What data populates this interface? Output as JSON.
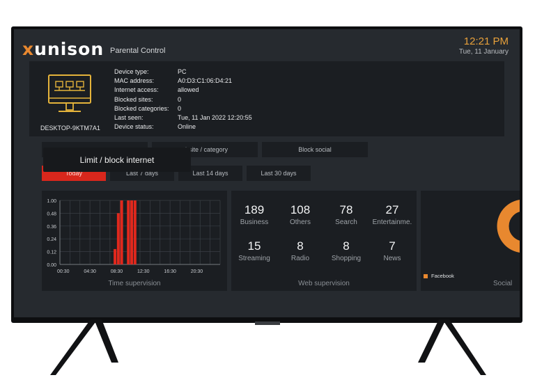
{
  "header": {
    "logo_x": "x",
    "logo_rest": "unison",
    "app_title": "Parental Control",
    "time": "12:21 PM",
    "date": "Tue, 11 January"
  },
  "device": {
    "name": "DESKTOP-9KTM7A1",
    "fields": [
      {
        "label": "Device type:",
        "value": "PC"
      },
      {
        "label": "MAC address:",
        "value": "A0:D3:C1:06:D4:21"
      },
      {
        "label": "Internet access:",
        "value": "allowed"
      },
      {
        "label": "Blocked sites:",
        "value": "0"
      },
      {
        "label": "Blocked categories:",
        "value": "0"
      },
      {
        "label": "Last seen:",
        "value": "Tue, 11 Jan 2022 12:20:55"
      },
      {
        "label": "Device status:",
        "value": "Online"
      }
    ]
  },
  "actions": {
    "block_category": "ebsite / category",
    "block_social": "Block social",
    "tooltip": "Limit / block internet"
  },
  "ranges": {
    "today": "Today",
    "last7": "Last 7 days",
    "last14": "Last 14 days",
    "last30": "Last 30 days"
  },
  "time_supervision": {
    "caption": "Time supervision"
  },
  "chart_data": {
    "type": "bar",
    "title": "",
    "xlabel": "",
    "ylabel": "",
    "x_ticks": [
      "00:30",
      "04:30",
      "08:30",
      "12:30",
      "16:30",
      "20:30"
    ],
    "y_ticks": [
      "0.00",
      "0.12",
      "0.24",
      "0.36",
      "0.48",
      "1.00"
    ],
    "ylim": [
      0,
      1.0
    ],
    "bar_color": "#e0281d",
    "categories": [
      "08:00",
      "08:30",
      "09:00",
      "10:00",
      "10:30",
      "11:00"
    ],
    "values": [
      0.24,
      0.8,
      1.0,
      1.0,
      1.0,
      1.0
    ]
  },
  "web_supervision": {
    "caption": "Web supervision",
    "stats": [
      {
        "value": "189",
        "label": "Business"
      },
      {
        "value": "108",
        "label": "Others"
      },
      {
        "value": "78",
        "label": "Search"
      },
      {
        "value": "27",
        "label": "Entertainme."
      },
      {
        "value": "15",
        "label": "Streaming"
      },
      {
        "value": "8",
        "label": "Radio"
      },
      {
        "value": "8",
        "label": "Shopping"
      },
      {
        "value": "7",
        "label": "News"
      }
    ]
  },
  "social": {
    "legend": "Facebook",
    "caption": "Social",
    "color": "#e8882f"
  }
}
